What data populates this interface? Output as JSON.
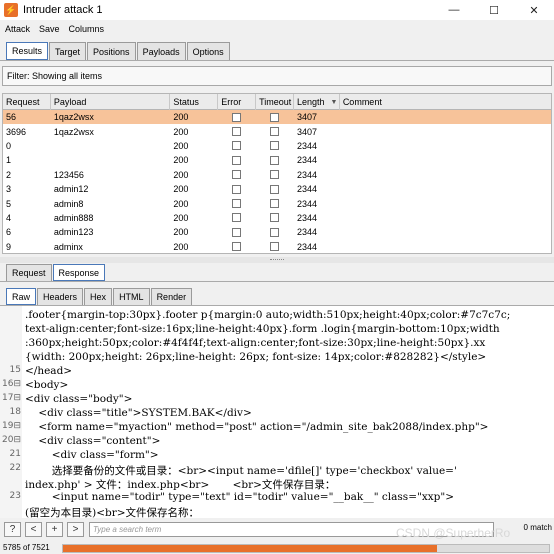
{
  "window": {
    "title": "Intruder attack 1",
    "controls": [
      "—",
      "☐",
      "✕"
    ]
  },
  "menu": [
    "Attack",
    "Save",
    "Columns"
  ],
  "main_tabs": [
    {
      "label": "Results",
      "active": true
    },
    {
      "label": "Target",
      "active": false
    },
    {
      "label": "Positions",
      "active": false
    },
    {
      "label": "Payloads",
      "active": false
    },
    {
      "label": "Options",
      "active": false
    }
  ],
  "filter": {
    "text": "Filter: Showing all items"
  },
  "table": {
    "columns": [
      "Request",
      "Payload",
      "Status",
      "Error",
      "Timeout",
      "Length",
      "Comment"
    ],
    "sort_column": "Length",
    "rows": [
      {
        "request": "56",
        "payload": "1qaz2wsx",
        "status": "200",
        "length": "3407",
        "selected": true
      },
      {
        "request": "3696",
        "payload": "1qaz2wsx",
        "status": "200",
        "length": "3407",
        "selected": false
      },
      {
        "request": "0",
        "payload": "",
        "status": "200",
        "length": "2344",
        "selected": false
      },
      {
        "request": "1",
        "payload": "",
        "status": "200",
        "length": "2344",
        "selected": false
      },
      {
        "request": "2",
        "payload": "123456",
        "status": "200",
        "length": "2344",
        "selected": false
      },
      {
        "request": "3",
        "payload": "admin12",
        "status": "200",
        "length": "2344",
        "selected": false
      },
      {
        "request": "5",
        "payload": "admin8",
        "status": "200",
        "length": "2344",
        "selected": false
      },
      {
        "request": "4",
        "payload": "admin888",
        "status": "200",
        "length": "2344",
        "selected": false
      },
      {
        "request": "6",
        "payload": "admin123",
        "status": "200",
        "length": "2344",
        "selected": false
      },
      {
        "request": "9",
        "payload": "adminx",
        "status": "200",
        "length": "2344",
        "selected": false
      }
    ]
  },
  "rr_tabs": [
    {
      "label": "Request",
      "active": false
    },
    {
      "label": "Response",
      "active": true
    }
  ],
  "view_tabs": [
    {
      "label": "Raw",
      "active": true
    },
    {
      "label": "Headers",
      "active": false
    },
    {
      "label": "Hex",
      "active": false
    },
    {
      "label": "HTML",
      "active": false
    },
    {
      "label": "Render",
      "active": false
    }
  ],
  "code_lines": [
    {
      "num": "",
      "text": ".footer{margin-top:30px}.footer p{margin:0 auto;width:510px;height:40px;color:#7c7c7c;"
    },
    {
      "num": "",
      "text": "text-align:center;font-size:16px;line-height:40px}.form .login{margin-bottom:10px;width"
    },
    {
      "num": "",
      "text": ":360px;height:50px;color:#4f4f4f;text-align:center;font-size:30px;line-height:50px}.xx"
    },
    {
      "num": "",
      "text": "{width: 200px;height: 26px;line-height: 26px; font-size: 14px;color:#828282}</style>"
    },
    {
      "num": "15",
      "text": "</head>"
    },
    {
      "num": "16⊟",
      "text": "<body>"
    },
    {
      "num": "17⊟",
      "text": "<div class=\"body\">"
    },
    {
      "num": "18",
      "text": "    <div class=\"title\">SYSTEM.BAK</div>"
    },
    {
      "num": "19⊟",
      "text": "    <form name=\"myaction\" method=\"post\" action=\"/admin_site_bak2088/index.php\">"
    },
    {
      "num": "20⊟",
      "text": "    <div class=\"content\">"
    },
    {
      "num": "21",
      "text": "        <div class=\"form\">"
    },
    {
      "num": "22",
      "text": "        选择要备份的文件或目录：<br><input name='dfile[]' type='checkbox' value='"
    },
    {
      "num": "",
      "text": "index.php' > 文件：index.php<br>       <br>文件保存目录："
    },
    {
      "num": "23",
      "text": "        <input name=\"todir\" type=\"text\" id=\"todir\" value=\"__bak__\" class=\"xxp\">"
    },
    {
      "num": "",
      "text": "(留空为本目录)<br>文件保存名称："
    }
  ],
  "search": {
    "buttons": [
      "?",
      "<",
      "+",
      ">"
    ],
    "placeholder": "Type a search term",
    "matches": "0 match"
  },
  "status": {
    "text": "5785 of 7521",
    "progress_fraction": 0.769
  },
  "watermark": "CSDN @SuperherRo",
  "colors": {
    "selected_row": "#f7c39a",
    "progress": "#e8702a",
    "tab_active_border": "#4a78b8"
  }
}
